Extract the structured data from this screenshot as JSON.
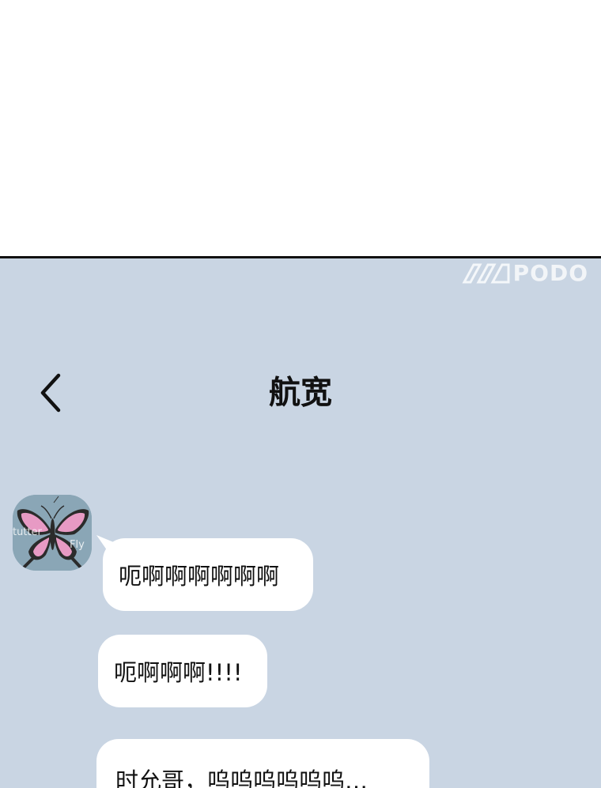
{
  "watermark": {
    "text": "PODO"
  },
  "header": {
    "back_icon": "chevron-left-icon",
    "title": "航宽"
  },
  "contact": {
    "avatar_icon": "butterfly-avatar",
    "avatar_text_left": "tutter",
    "avatar_text_right": "Fly"
  },
  "messages": [
    {
      "text": "呃啊啊啊啊啊啊"
    },
    {
      "text": "呃啊啊啊!!!!"
    },
    {
      "text": "时允哥，呜呜呜呜呜呜…"
    }
  ],
  "colors": {
    "chat_background": "#c9d5e3",
    "bubble": "#ffffff",
    "text": "#111111",
    "butterfly_wing": "#e79ac4",
    "butterfly_body": "#2b2b2b"
  }
}
